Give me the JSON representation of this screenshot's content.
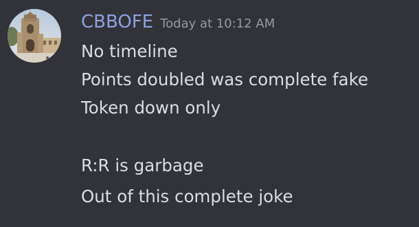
{
  "message": {
    "author": "CBBOFE",
    "timestamp": "Today at 10:12 AM",
    "avatar_icon": "cathedral-photo-avatar",
    "lines": [
      "No timeline",
      "Points doubled was complete fake",
      "Token down only",
      "",
      "R:R is garbage",
      "Out of this complete joke"
    ]
  },
  "colors": {
    "background": "#313338",
    "username": "#8ea1e1",
    "timestamp": "#949ba4",
    "text": "#dbdee1"
  }
}
